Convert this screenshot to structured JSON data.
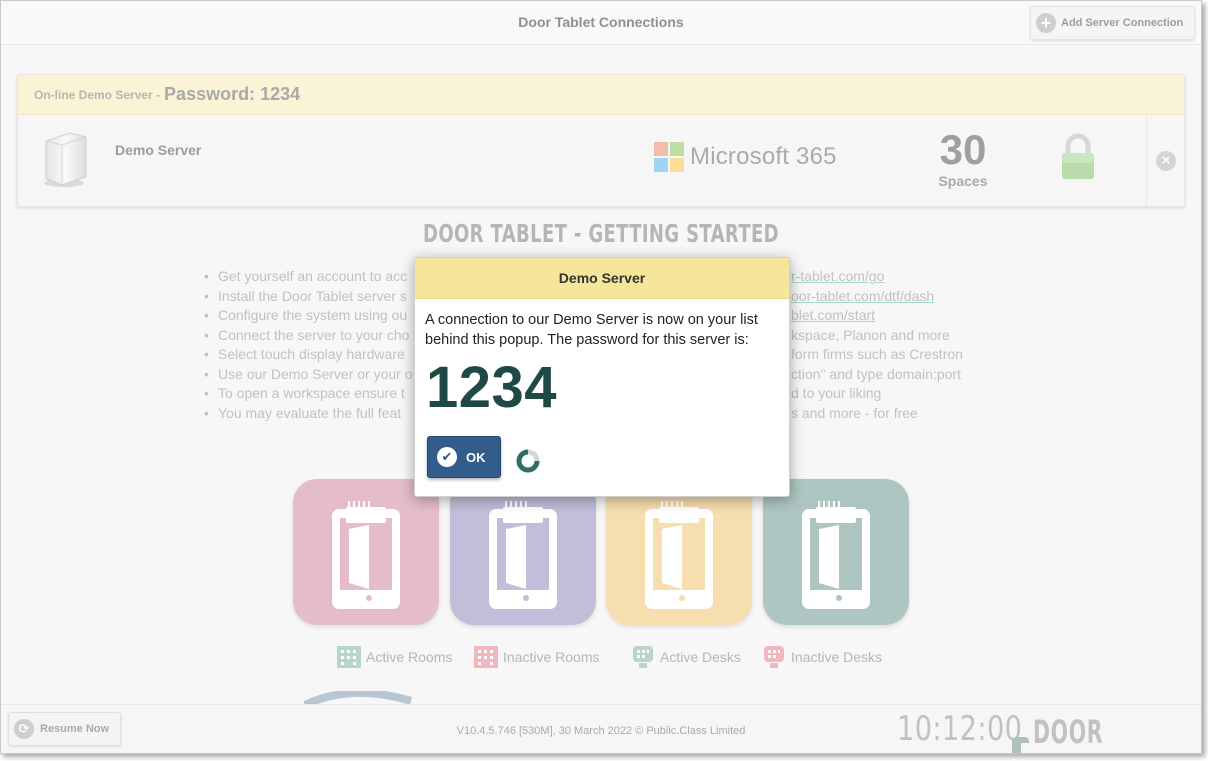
{
  "titlebar": {
    "title": "Door Tablet Connections",
    "add_button_label": "Add Server Connection"
  },
  "server_panel": {
    "header_label": "On-line Demo Server -",
    "header_password": "Password: 1234",
    "server_name": "Demo Server",
    "provider": "Microsoft 365",
    "spaces_count": "30",
    "spaces_label": "Spaces"
  },
  "getting_started": {
    "title": "DOOR TABLET - GETTING STARTED",
    "items": [
      {
        "left": "Get yourself an account to acc",
        "right": "r-tablet.com/go",
        "link": true
      },
      {
        "left": "Install the Door Tablet server s",
        "right": "oor-tablet.com/dtf/dash",
        "link": true
      },
      {
        "left": "Configure the system using ou",
        "right": "blet.com/start",
        "link": true
      },
      {
        "left": "Connect the server to your cho",
        "right": "kspace, Planon and more",
        "link": false
      },
      {
        "left": "Select touch display hardware",
        "right": "form firms such as Crestron",
        "link": false
      },
      {
        "left": "Use our Demo Server or your o",
        "right": "ction\" and type domain:port",
        "link": false
      },
      {
        "left": "To open a workspace ensure t",
        "right": "d to your liking",
        "link": false
      },
      {
        "left": "You may evaluate the full feat",
        "right": "s and more - for free",
        "link": false
      }
    ]
  },
  "legend": [
    {
      "label": "Active Rooms",
      "color": "#7fb3a9"
    },
    {
      "label": "Inactive Rooms",
      "color": "#e88a98"
    },
    {
      "label": "Active Desks",
      "color": "#7fb3a9"
    },
    {
      "label": "Inactive Desks",
      "color": "#e88a98"
    }
  ],
  "footer": {
    "resume_label": "Resume Now",
    "version": "V10.4.5.746 [530M], 30 March 2022 © Public.Class Limited",
    "clock": "10:12:00",
    "brand": "DOOR TABLET"
  },
  "dialog": {
    "title": "Demo Server",
    "message": "A connection to our Demo Server is now on your list behind this popup. The password for this server is:",
    "password": "1234",
    "ok_label": "OK"
  },
  "colors": {
    "tile_pink": "#dba4b6",
    "tile_purple": "#a8a6c9",
    "tile_yellow": "#f3d290",
    "tile_teal": "#8fb0aa",
    "dialog_header": "#f6e69a",
    "ok_button": "#325c8a",
    "password_text": "#1f4945"
  }
}
